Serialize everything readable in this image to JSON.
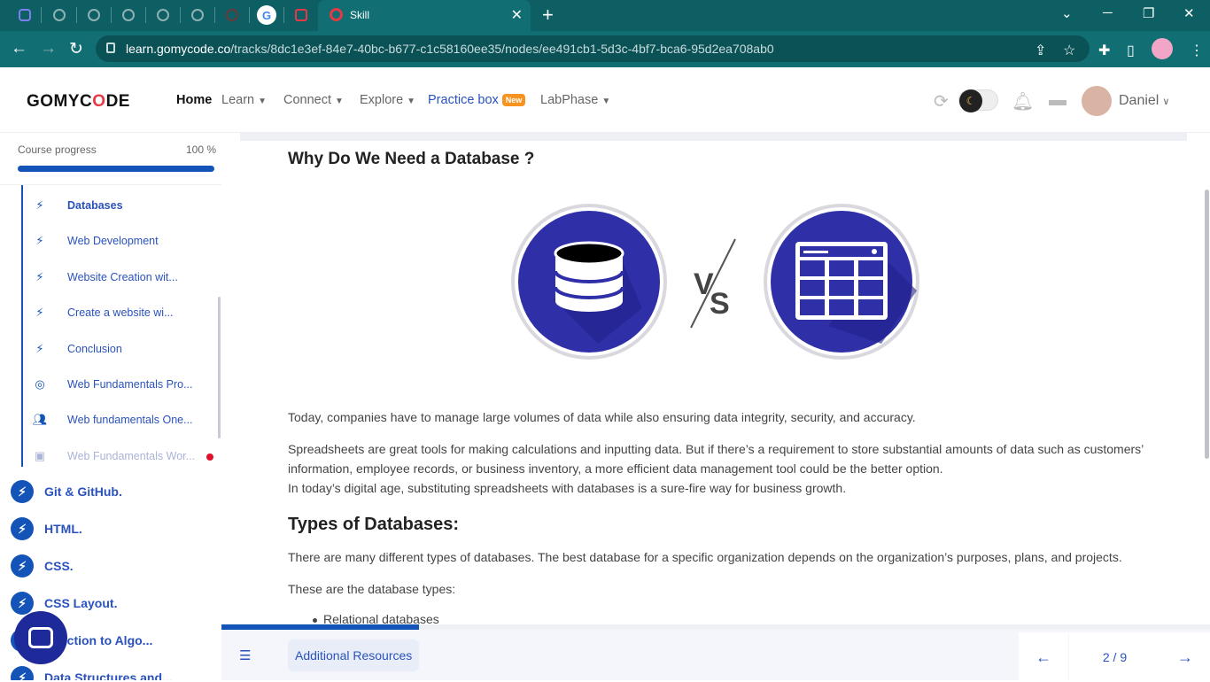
{
  "browser": {
    "active_tab_title": "Skill",
    "url_host": "learn.gomycode.co",
    "url_path": "/tracks/8dc1e3ef-84e7-40bc-b677-c1c58160ee35/nodes/ee491cb1-5d3c-4bf7-bca6-95d2ea708ab0",
    "new_tab_label": "+",
    "close_tab_label": "✕"
  },
  "header": {
    "logo_text": "GOMYC",
    "logo_accent": "O",
    "logo_tail": "DE",
    "nav": {
      "home": "Home",
      "learn": "Learn",
      "connect": "Connect",
      "explore": "Explore",
      "practice": "Practice box",
      "practice_badge": "New",
      "labphase": "LabPhase"
    },
    "username": "Daniel"
  },
  "sidebar": {
    "progress_label": "Course progress",
    "progress_value": "100 %",
    "progress_fraction": 1.0,
    "sub_items": [
      {
        "label": "Databases",
        "icon": "bolt-icon",
        "state": "active"
      },
      {
        "label": "Web Development",
        "icon": "bolt-icon",
        "state": "normal"
      },
      {
        "label": "Website Creation wit...",
        "icon": "bolt-icon",
        "state": "normal"
      },
      {
        "label": "Create a website wi...",
        "icon": "bolt-icon",
        "state": "normal"
      },
      {
        "label": "Conclusion",
        "icon": "bolt-icon",
        "state": "normal"
      },
      {
        "label": "Web Fundamentals Pro...",
        "icon": "target-icon",
        "state": "normal"
      },
      {
        "label": "Web fundamentals One...",
        "icon": "people-icon",
        "state": "normal"
      },
      {
        "label": "Web Fundamentals Wor...",
        "icon": "workshop-icon",
        "state": "faded"
      }
    ],
    "tracks": [
      {
        "label": "Git & GitHub."
      },
      {
        "label": "HTML."
      },
      {
        "label": "CSS."
      },
      {
        "label": "CSS Layout."
      },
      {
        "label": "oduction to Algo..."
      },
      {
        "label": "Data Structures and..."
      }
    ]
  },
  "content": {
    "heading": "Why Do We Need a Database ?",
    "vs_label": "VS",
    "para1": "Today, companies have to manage large volumes of data while also ensuring data integrity, security, and accuracy.",
    "para2a": "Spreadsheets are great tools for making calculations and inputting data. But if there’s a requirement to store substantial amounts of data such as customers’ information, employee records, or business inventory, a more efficient data management tool could be the better option.",
    "para2b": "In today’s digital age, substituting spreadsheets with databases is a sure-fire way for business growth.",
    "types_heading": "Types of Databases:",
    "para3": "There are many different types of databases. The best database for a specific organization depends on the organization’s purposes, plans, and projects.",
    "para4": "These are the database types:",
    "bullet1": "Relational databases"
  },
  "footer": {
    "resources_label": "Additional Resources",
    "page_indicator": "2 / 9",
    "page_progress_fraction": 0.2,
    "prev_icon": "arrow-left-icon",
    "next_icon": "arrow-right-icon"
  },
  "colors": {
    "brand_blue": "#1454b8",
    "link_blue": "#2a52be",
    "accent_red": "#e63946",
    "badge_orange": "#f7931e",
    "chrome_teal": "#116e72"
  }
}
